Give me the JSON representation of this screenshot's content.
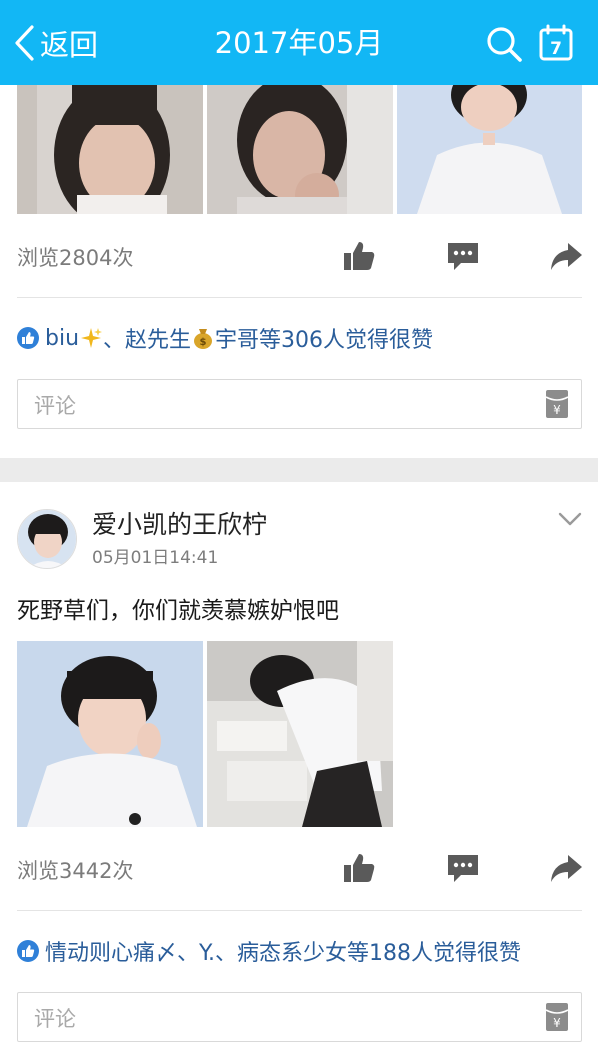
{
  "header": {
    "back_label": "返回",
    "title": "2017年05月",
    "calendar_day": "7"
  },
  "post1": {
    "views": "浏览2804次",
    "likes_prefix": "biu",
    "likes_mid": "、赵先生",
    "likes_suffix": "宇哥等306人觉得很赞",
    "comment_placeholder": "评论"
  },
  "post2": {
    "author": "爱小凯的王欣柠",
    "timestamp": "05月01日14:41",
    "text": "死野草们，你们就羡慕嫉妒恨吧",
    "views": "浏览3442次",
    "likes": "情动则心痛〆、Y.、病态系少女等188人觉得很赞",
    "comment_placeholder": "评论"
  },
  "icons": {
    "gift_symbol": "¥"
  },
  "colors": {
    "header_bg": "#12b7f5",
    "link": "#2a5d9a",
    "muted": "#7b7b7b"
  }
}
